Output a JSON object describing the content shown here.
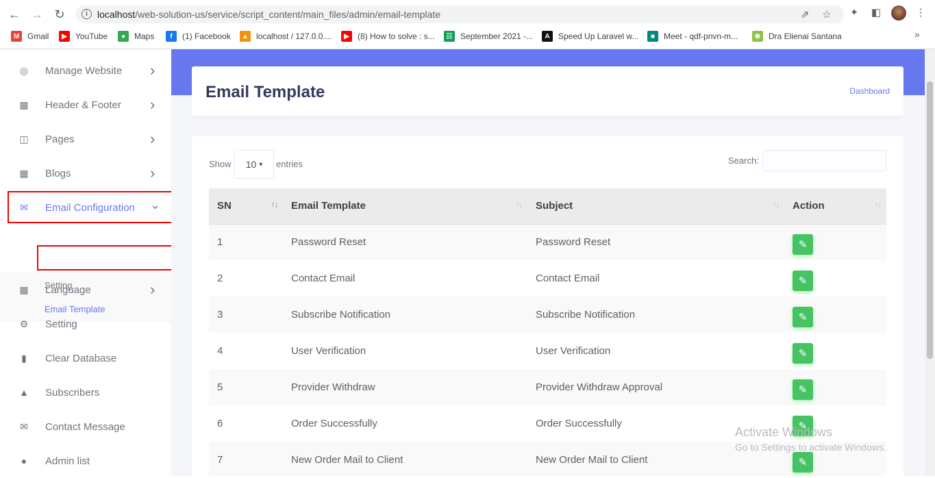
{
  "browser": {
    "url_host": "localhost",
    "url_path": "/web-solution-us/service/script_content/main_files/admin/email-template",
    "bookmarks": [
      {
        "label": "Gmail",
        "icon": "gmail-icon",
        "color": "#ea4335"
      },
      {
        "label": "YouTube",
        "icon": "youtube-icon",
        "color": "#ff0000"
      },
      {
        "label": "Maps",
        "icon": "maps-icon",
        "color": "#34a853"
      },
      {
        "label": "(1) Facebook",
        "icon": "facebook-icon",
        "color": "#1877f2"
      },
      {
        "label": "localhost / 127.0.0....",
        "icon": "phpmyadmin-icon",
        "color": "#f29111"
      },
      {
        "label": "(8) How to solve : s...",
        "icon": "youtube-icon",
        "color": "#ff0000"
      },
      {
        "label": "September 2021 -...",
        "icon": "sheets-icon",
        "color": "#0f9d58"
      },
      {
        "label": "Speed Up Laravel w...",
        "icon": "laravel-icon",
        "color": "#111111"
      },
      {
        "label": "Meet - qdf-pnvn-m...",
        "icon": "meet-icon",
        "color": "#00897b"
      },
      {
        "label": "Dra Elienai Santana",
        "icon": "site-icon",
        "color": "#8bc34a"
      }
    ]
  },
  "sidebar": {
    "items": [
      {
        "label": "Manage Website",
        "icon": "globe-icon",
        "has_chevron": true
      },
      {
        "label": "Header & Footer",
        "icon": "grid-icon",
        "has_chevron": true
      },
      {
        "label": "Pages",
        "icon": "columns-icon",
        "has_chevron": true
      },
      {
        "label": "Blogs",
        "icon": "grid-icon",
        "has_chevron": true
      },
      {
        "label": "Email Configuration",
        "icon": "envelope-icon",
        "has_chevron": true,
        "active": true
      },
      {
        "label": "Language",
        "icon": "grid-icon",
        "has_chevron": true
      },
      {
        "label": "Setting",
        "icon": "gear-icon",
        "has_chevron": false
      },
      {
        "label": "Clear Database",
        "icon": "trash-icon",
        "has_chevron": false
      },
      {
        "label": "Subscribers",
        "icon": "fire-icon",
        "has_chevron": false
      },
      {
        "label": "Contact Message",
        "icon": "envelope-icon",
        "has_chevron": false
      },
      {
        "label": "Admin list",
        "icon": "user-icon",
        "has_chevron": false
      }
    ],
    "submenu": [
      {
        "label": "Setting",
        "active": false
      },
      {
        "label": "Email Template",
        "active": true
      }
    ]
  },
  "header": {
    "title": "Email Template",
    "breadcrumb": "Dashboard"
  },
  "table": {
    "show_label": "Show",
    "page_length": "10",
    "entries_label": "entries",
    "search_label": "Search:",
    "search_value": "",
    "columns": [
      "SN",
      "Email Template",
      "Subject",
      "Action"
    ],
    "rows": [
      {
        "sn": "1",
        "template": "Password Reset",
        "subject": "Password Reset"
      },
      {
        "sn": "2",
        "template": "Contact Email",
        "subject": "Contact Email"
      },
      {
        "sn": "3",
        "template": "Subscribe Notification",
        "subject": "Subscribe Notification"
      },
      {
        "sn": "4",
        "template": "User Verification",
        "subject": "User Verification"
      },
      {
        "sn": "5",
        "template": "Provider Withdraw",
        "subject": "Provider Withdraw Approval"
      },
      {
        "sn": "6",
        "template": "Order Successfully",
        "subject": "Order Successfully"
      },
      {
        "sn": "7",
        "template": "New Order Mail to Client",
        "subject": "New Order Mail to Client"
      }
    ]
  },
  "watermark": {
    "line1": "Activate Windows",
    "line2": "Go to Settings to activate Windows."
  },
  "colors": {
    "accent": "#6777ef",
    "success": "#47c363",
    "highlight_box": "#e00000"
  }
}
